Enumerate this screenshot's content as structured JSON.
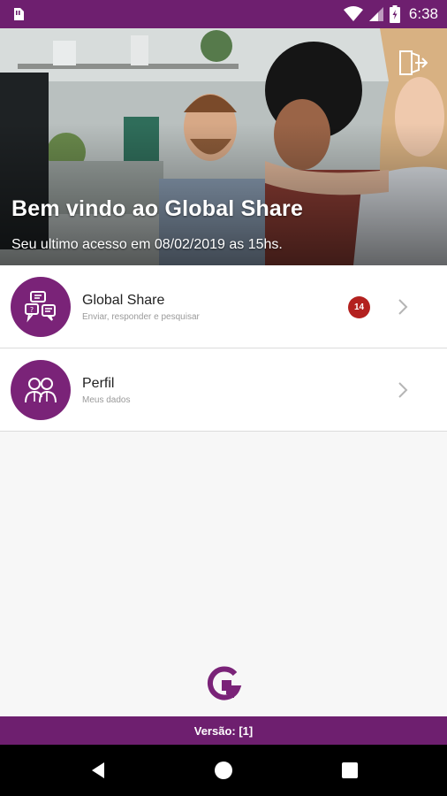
{
  "status_bar": {
    "time": "6:38",
    "icons": [
      "notification-icon",
      "wifi-icon",
      "signal-icon",
      "battery-icon"
    ]
  },
  "hero": {
    "title": "Bem vindo ao Global Share",
    "subtitle": "Seu ultimo acesso em 08/02/2019 as 15hs.",
    "logout_icon": "logout-icon"
  },
  "menu": {
    "items": [
      {
        "title": "Global Share",
        "subtitle": "Enviar, responder e pesquisar",
        "badge": "14",
        "icon": "chat-icon"
      },
      {
        "title": "Perfil",
        "subtitle": "Meus dados",
        "icon": "people-icon"
      }
    ]
  },
  "footer": {
    "logo": "global-share-logo",
    "version": "Versão: [1]"
  },
  "colors": {
    "brand": "#6e1f6f",
    "circle": "#7a2378",
    "badge": "#b3211f"
  }
}
